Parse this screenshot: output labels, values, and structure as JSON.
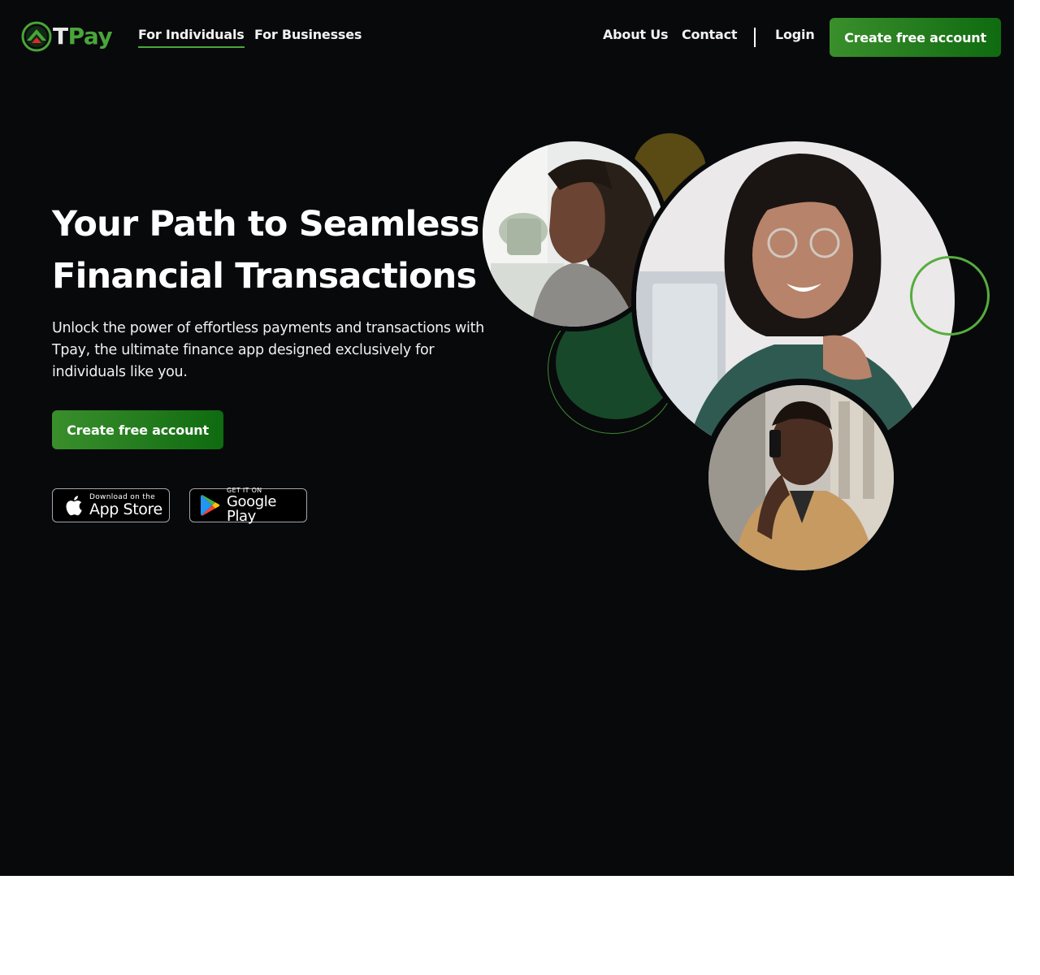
{
  "brand": {
    "name_t": "T",
    "name_rest": "Pay"
  },
  "nav": {
    "left_links": [
      "For Individuals",
      "For Businesses"
    ],
    "right_links": [
      "About Us",
      "Contact"
    ],
    "login": "Login",
    "cta": "Create free account",
    "active": "For Individuals"
  },
  "hero": {
    "headline": "Your Path to Seamless Financial Transactions",
    "subtext": "Unlock the power of effortless payments and transactions with Tpay, the ultimate finance app designed exclusively for individuals like you.",
    "cta": "Create free account"
  },
  "badges": {
    "apple_small": "Download on the",
    "apple_big": "App Store",
    "google_small": "GET IT ON",
    "google_big": "Google Play"
  },
  "colors": {
    "background": "#08090b",
    "accent_green": "#49a83a",
    "button_green_start": "#3a8f2c",
    "button_green_end": "#0f6b10",
    "olive": "#5a4a14",
    "dark_green": "#17482a"
  },
  "icons": {
    "logo": "tpay-logo-icon",
    "apple": "apple-icon",
    "google_play": "google-play-icon"
  }
}
